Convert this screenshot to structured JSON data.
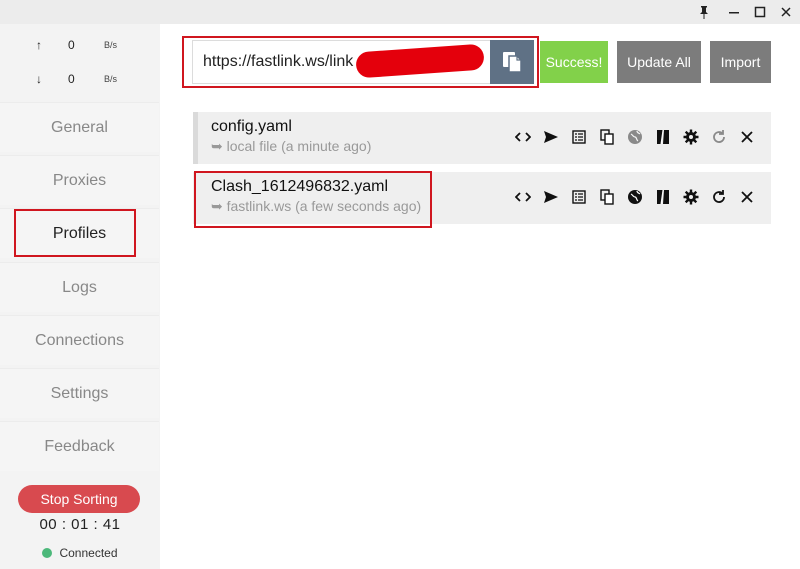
{
  "window": {
    "pin_icon": "pin-icon",
    "minimize_icon": "minimize-icon",
    "maximize_icon": "maximize-icon",
    "close_icon": "close-icon"
  },
  "traffic": {
    "upload": {
      "arrow": "↑",
      "value": "0",
      "unit": "B/s"
    },
    "download": {
      "arrow": "↓",
      "value": "0",
      "unit": "B/s"
    }
  },
  "sidebar": {
    "items": [
      {
        "label": "General"
      },
      {
        "label": "Proxies"
      },
      {
        "label": "Profiles",
        "active": true
      },
      {
        "label": "Logs"
      },
      {
        "label": "Connections"
      },
      {
        "label": "Settings"
      },
      {
        "label": "Feedback"
      }
    ],
    "stop_sorting_label": "Stop Sorting",
    "timer": "00 : 01 : 41",
    "status": "Connected",
    "status_color": "#4cb87a"
  },
  "toolbar": {
    "url_value": "https://fastlink.ws/link",
    "success_label": "Success!",
    "update_all_label": "Update All",
    "import_label": "Import",
    "success_color": "#82d14a",
    "button_color": "#7c7c7c",
    "paste_icon": "paste-icon"
  },
  "profiles": [
    {
      "name": "config.yaml",
      "source": "➥ local file (a minute ago)",
      "selected": false
    },
    {
      "name": "Clash_1612496832.yaml",
      "source": "➥ fastlink.ws (a few seconds ago)",
      "selected": true
    }
  ],
  "profile_actions": [
    "code-icon",
    "send-icon",
    "list-icon",
    "copy-icon",
    "globe-icon",
    "mapping-icon",
    "gear-icon",
    "refresh-icon",
    "close-icon"
  ],
  "annotations": {
    "highlight_color": "#d0161f",
    "redaction_color": "#e4000c"
  }
}
